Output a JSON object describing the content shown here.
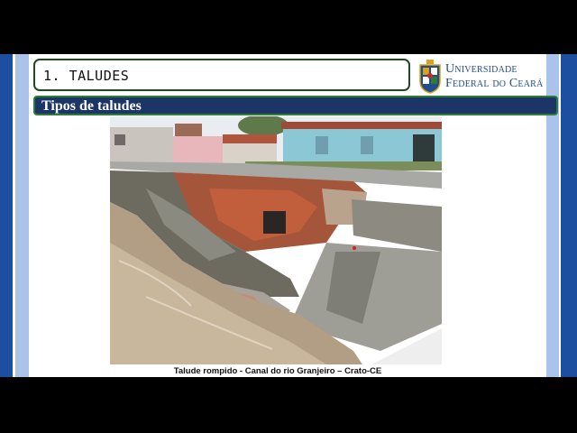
{
  "slide": {
    "section_title": "1. TALUDES",
    "subtitle": "Tipos de taludes",
    "caption": "Talude rompido - Canal do rio Granjeiro – Crato-CE"
  },
  "logo": {
    "line1": "Universidade",
    "line2": "Federal do Ceará",
    "icon": "ufc-crest-icon"
  },
  "photo": {
    "subject": "collapsed-slope-river-canal"
  },
  "colors": {
    "band_dark": "#1d4fa0",
    "band_light": "#a9c3ea",
    "subtitle_bg": "#1a3566",
    "title_border": "#1e4a22",
    "logo_text": "#1f4d8f"
  }
}
